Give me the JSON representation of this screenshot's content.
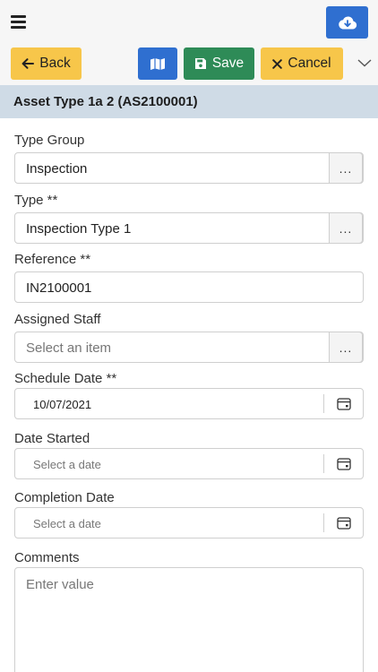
{
  "toolbar": {
    "back_label": "Back",
    "save_label": "Save",
    "cancel_label": "Cancel"
  },
  "header": {
    "title": "Asset Type 1a 2 (AS2100001)"
  },
  "form": {
    "type_group": {
      "label": "Type Group",
      "value": "Inspection"
    },
    "type": {
      "label": "Type **",
      "value": "Inspection Type 1"
    },
    "reference": {
      "label": "Reference **",
      "value": "IN2100001"
    },
    "assigned_staff": {
      "label": "Assigned Staff",
      "placeholder": "Select an item"
    },
    "schedule_date": {
      "label": "Schedule Date **",
      "value": "10/07/2021"
    },
    "date_started": {
      "label": "Date Started",
      "placeholder": "Select a date"
    },
    "completion_date": {
      "label": "Completion Date",
      "placeholder": "Select a date"
    },
    "comments": {
      "label": "Comments",
      "placeholder": "Enter value"
    },
    "lookup_glyph": "..."
  },
  "icons": {
    "menu": "hamburger-icon",
    "cloud": "cloud-download-icon",
    "back": "arrow-left-icon",
    "map": "map-icon",
    "save": "floppy-disk-icon",
    "cancel": "x-icon",
    "more": "chevron-down-icon",
    "calendar": "calendar-icon"
  },
  "colors": {
    "primary_blue": "#2f6fd0",
    "warning_yellow": "#f7c64a",
    "success_green": "#2e8b57",
    "header_band": "#cfdbe6"
  }
}
